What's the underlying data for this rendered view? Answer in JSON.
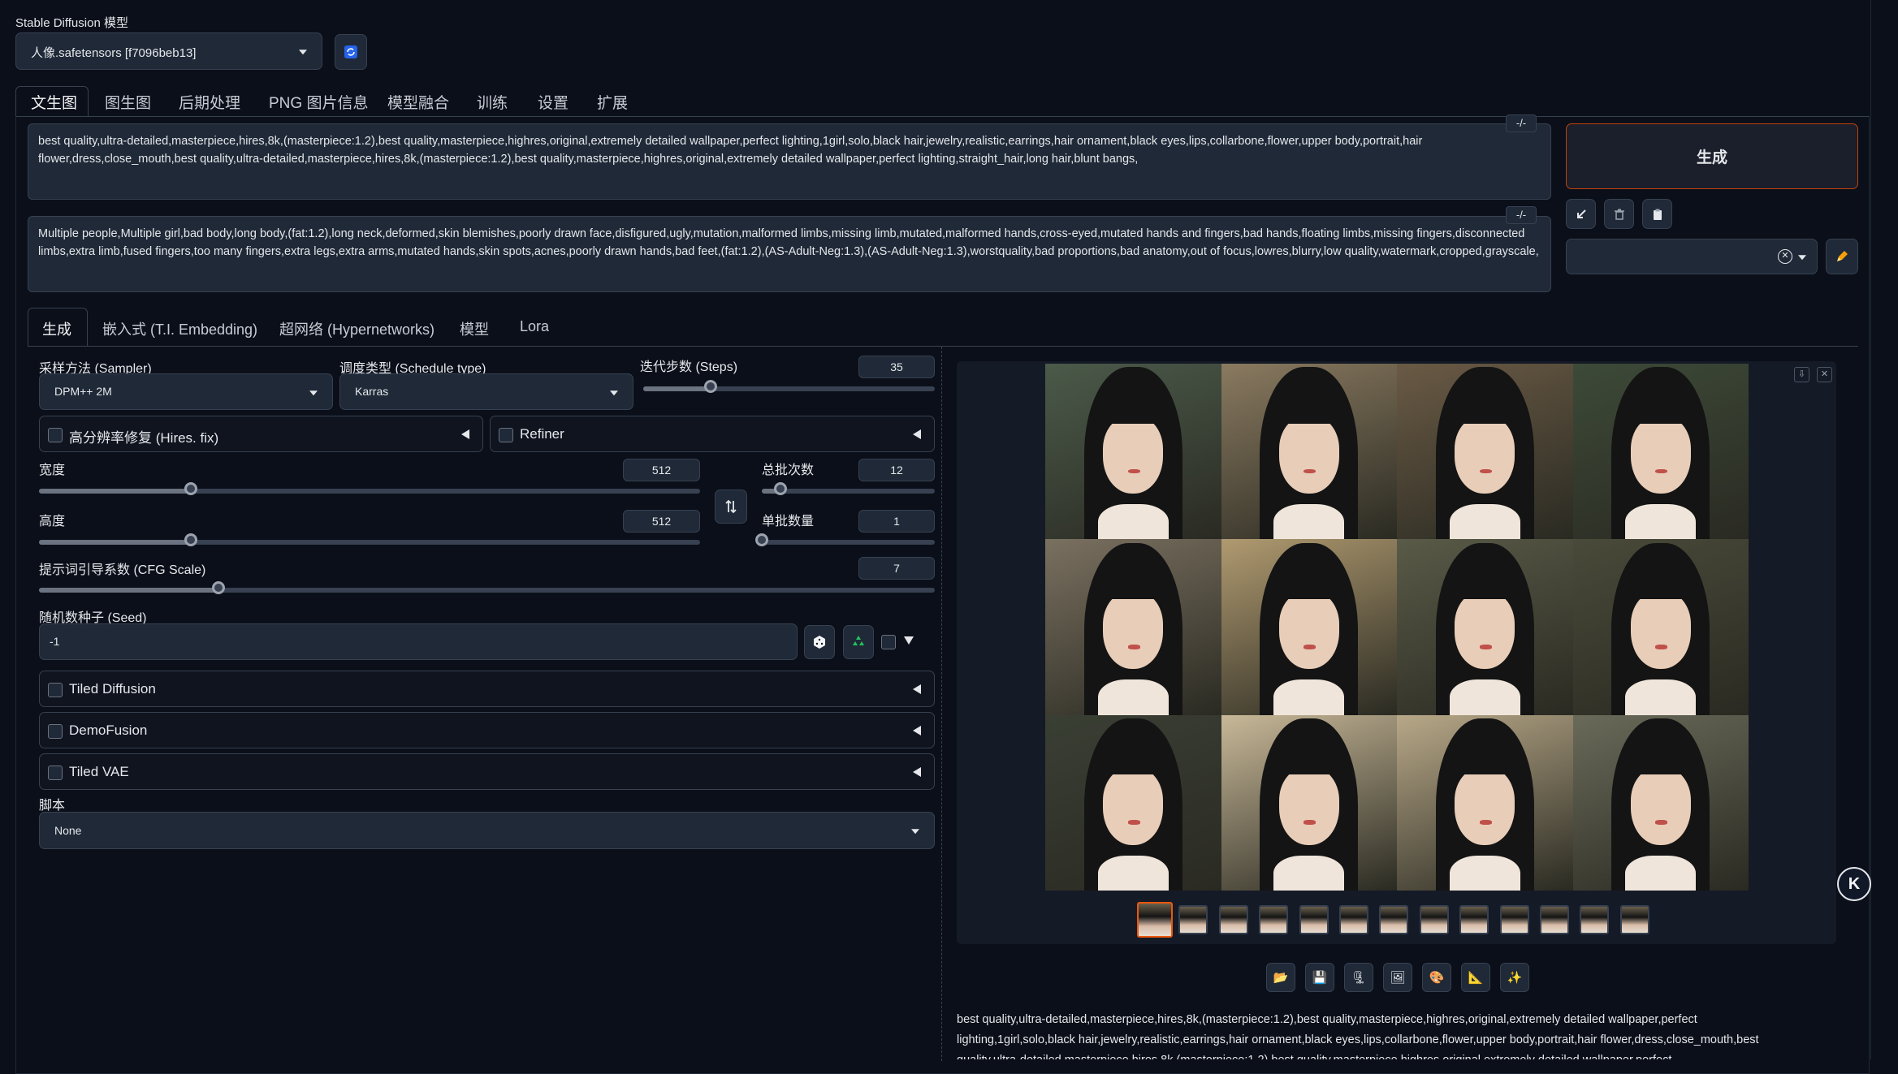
{
  "model": {
    "label": "Stable Diffusion 模型",
    "selected": "人像.safetensors [f7096beb13]"
  },
  "main_tabs": [
    "文生图",
    "图生图",
    "后期处理",
    "PNG 图片信息",
    "模型融合",
    "训练",
    "设置",
    "扩展"
  ],
  "prompt": {
    "positive": "best quality,ultra-detailed,masterpiece,hires,8k,(masterpiece:1.2),best quality,masterpiece,highres,original,extremely detailed wallpaper,perfect lighting,1girl,solo,black hair,jewelry,realistic,earrings,hair ornament,black eyes,lips,collarbone,flower,upper body,portrait,hair flower,dress,close_mouth,best quality,ultra-detailed,masterpiece,hires,8k,(masterpiece:1.2),best quality,masterpiece,highres,original,extremely detailed wallpaper,perfect lighting,straight_hair,long hair,blunt bangs,",
    "negative": "Multiple people,Multiple girl,bad body,long body,(fat:1.2),long neck,deformed,skin blemishes,poorly drawn face,disfigured,ugly,mutation,malformed limbs,missing limb,mutated,malformed hands,cross-eyed,mutated hands and fingers,bad hands,floating limbs,missing fingers,disconnected limbs,extra limb,fused fingers,too many fingers,extra legs,extra arms,mutated hands,skin spots,acnes,poorly drawn hands,bad feet,(fat:1.2),(AS-Adult-Neg:1.3),(AS-Adult-Neg:1.3),worstquality,bad proportions,bad anatomy,out of focus,lowres,blurry,low quality,watermark,cropped,grayscale,",
    "toggle": "-/-"
  },
  "generate_button": "生成",
  "sub_tabs": [
    "生成",
    "嵌入式 (T.I. Embedding)",
    "超网络 (Hypernetworks)",
    "模型",
    "Lora"
  ],
  "params": {
    "sampler_label": "采样方法 (Sampler)",
    "sampler_value": "DPM++ 2M",
    "schedule_label": "调度类型 (Schedule type)",
    "schedule_value": "Karras",
    "steps_label": "迭代步数 (Steps)",
    "steps_value": "35",
    "steps_fraction": 0.23,
    "hires_label": "高分辨率修复 (Hires. fix)",
    "refiner_label": "Refiner",
    "width_label": "宽度",
    "width_value": "512",
    "width_fraction": 0.23,
    "height_label": "高度",
    "height_value": "512",
    "height_fraction": 0.23,
    "batch_count_label": "总批次数",
    "batch_count_value": "12",
    "batch_count_fraction": 0.11,
    "batch_size_label": "单批数量",
    "batch_size_value": "1",
    "batch_size_fraction": 0.0,
    "cfg_label": "提示词引导系数 (CFG Scale)",
    "cfg_value": "7",
    "cfg_fraction": 0.2,
    "seed_label": "随机数种子 (Seed)",
    "seed_value": "-1",
    "extensions": [
      "Tiled Diffusion",
      "DemoFusion",
      "Tiled VAE"
    ],
    "script_label": "脚本",
    "script_value": "None"
  },
  "output_caption": "best quality,ultra-detailed,masterpiece,hires,8k,(masterpiece:1.2),best quality,masterpiece,highres,original,extremely detailed wallpaper,perfect lighting,1girl,solo,black hair,jewelry,realistic,earrings,hair ornament,black eyes,lips,collarbone,flower,upper body,portrait,hair flower,dress,close_mouth,best quality,ultra-detailed,masterpiece,hires,8k,(masterpiece:1.2),best quality,masterpiece,highres,original,extremely detailed wallpaper,perfect lighting,straight_hair,long hair,blunt bangs,",
  "colors": {
    "background": "#0b0f19",
    "panel": "#1f2937",
    "border": "#374151",
    "accent_orange": "#ea580c",
    "recycle_green": "#22c55e",
    "refresh_blue": "#2563eb"
  },
  "icons": {
    "refresh": "refresh-icon",
    "arrow": "arrow-icon",
    "trash": "trash-icon",
    "clipboard": "clipboard-icon",
    "pencil": "pencil-icon",
    "swap": "swap-icon",
    "dice": "dice-icon",
    "recycle": "recycle-icon",
    "folder": "folder-icon",
    "save": "save-icon",
    "zip": "zip-icon",
    "image": "image-icon",
    "palette": "palette-icon",
    "ruler": "ruler-icon",
    "sparkle": "sparkle-icon"
  }
}
